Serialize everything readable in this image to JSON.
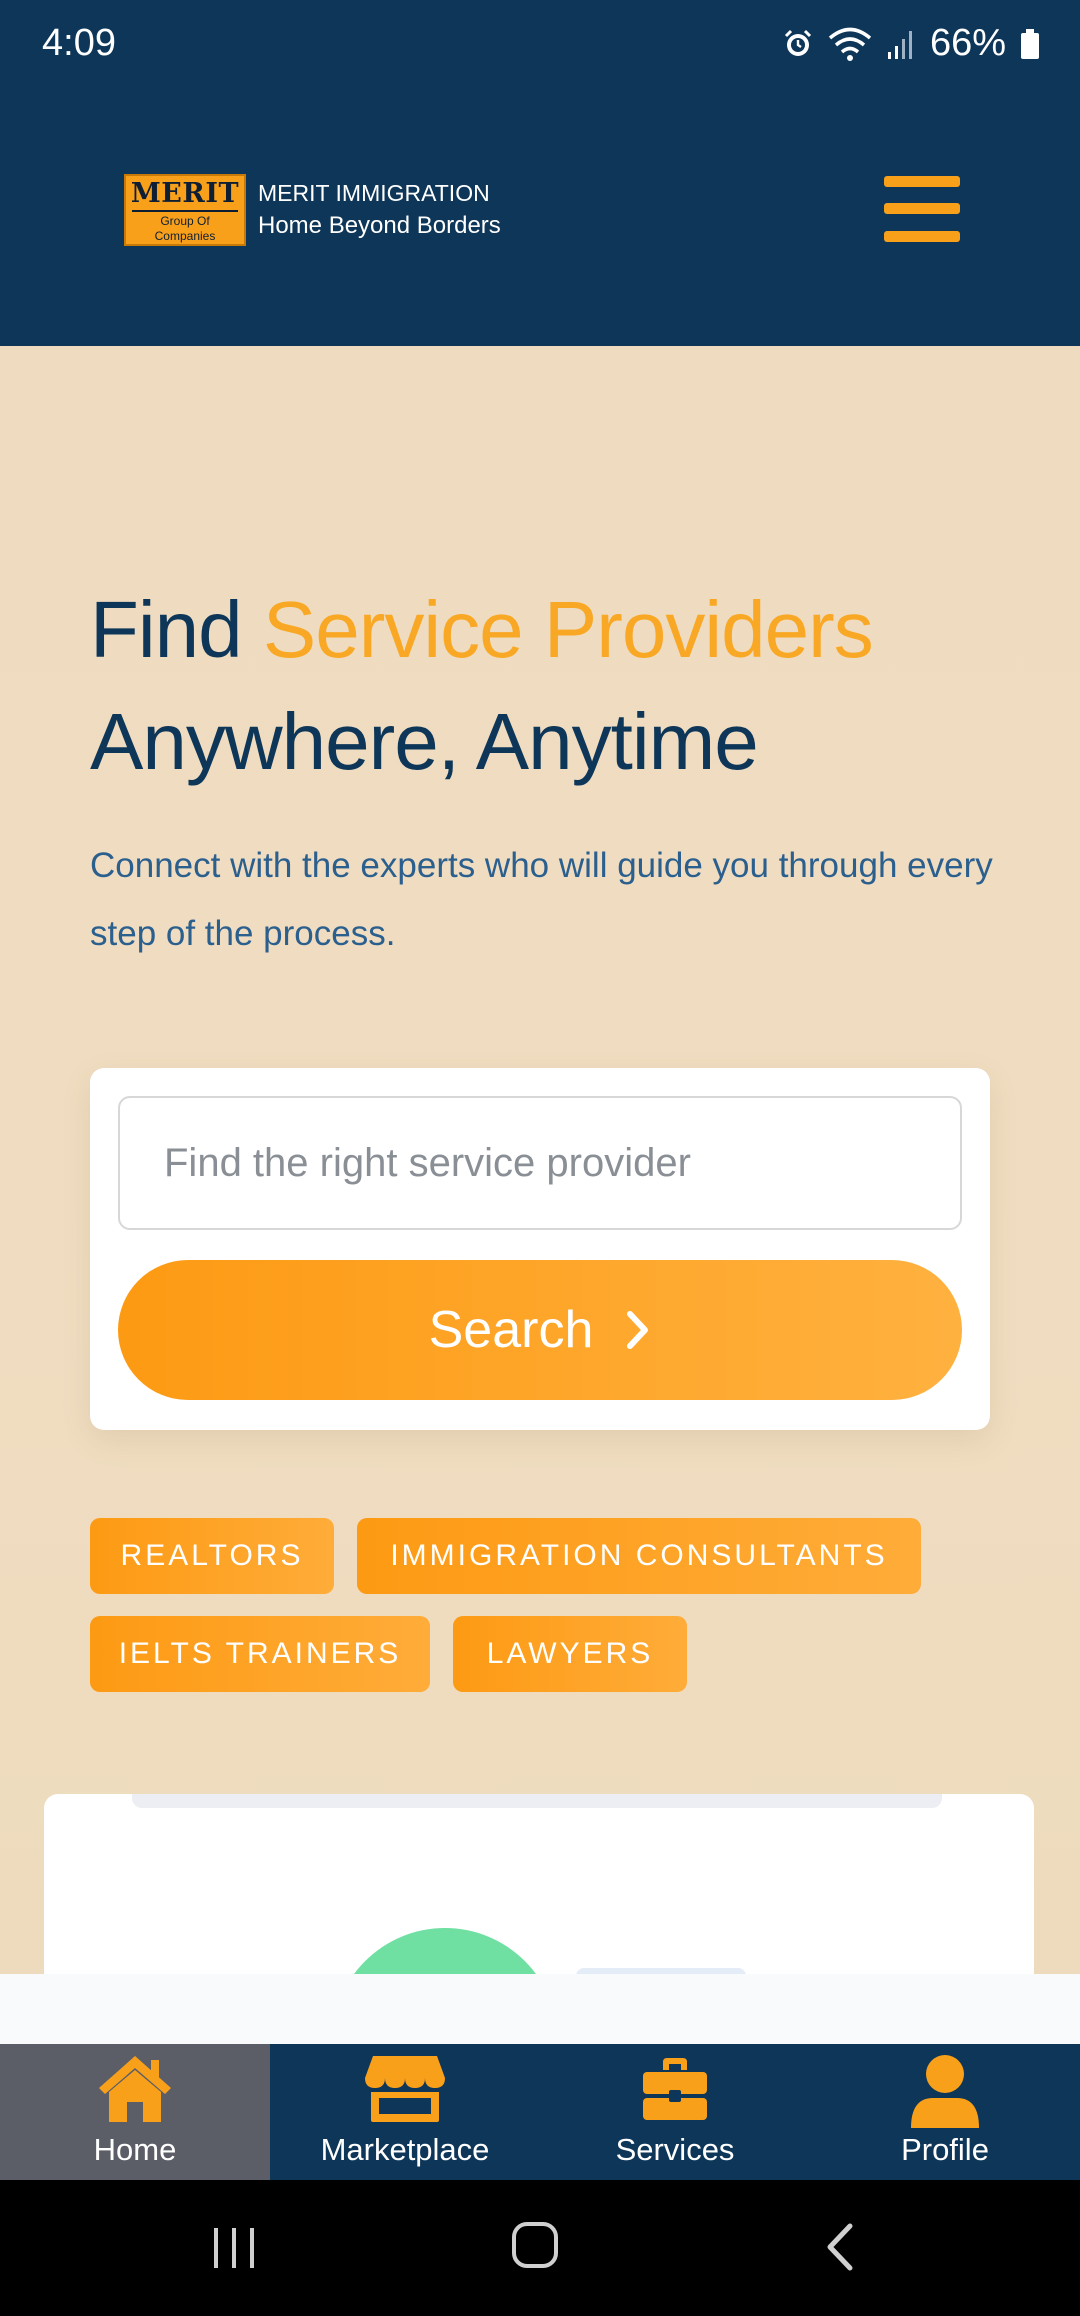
{
  "status_bar": {
    "time": "4:09",
    "battery": "66%"
  },
  "header": {
    "logo": {
      "title": "MERIT",
      "sub_line1": "Group Of",
      "sub_line2": "Companies"
    },
    "brand_name": "MERIT IMMIGRATION",
    "tagline": "Home Beyond Borders"
  },
  "hero": {
    "title_part1": "Find ",
    "title_accent": "Service Providers",
    "title_part2": "Anywhere, Anytime",
    "description": "Connect with the experts who will guide you through every step of the process."
  },
  "search": {
    "placeholder": "Find the right service provider",
    "button_label": "Search"
  },
  "categories": [
    "REALTORS",
    "IMMIGRATION CONSULTANTS",
    "IELTS TRAINERS",
    "LAWYERS"
  ],
  "bottom_nav": {
    "items": [
      {
        "label": "Home",
        "icon": "home-icon",
        "active": true
      },
      {
        "label": "Marketplace",
        "icon": "store-icon",
        "active": false
      },
      {
        "label": "Services",
        "icon": "briefcase-icon",
        "active": false
      },
      {
        "label": "Profile",
        "icon": "user-icon",
        "active": false
      }
    ]
  },
  "colors": {
    "navy": "#0e3658",
    "accent_orange": "#f9a01b",
    "hero_bg": "#f0dcbf",
    "text_blue": "#2b5f8e",
    "active_nav": "#5b5e66"
  }
}
